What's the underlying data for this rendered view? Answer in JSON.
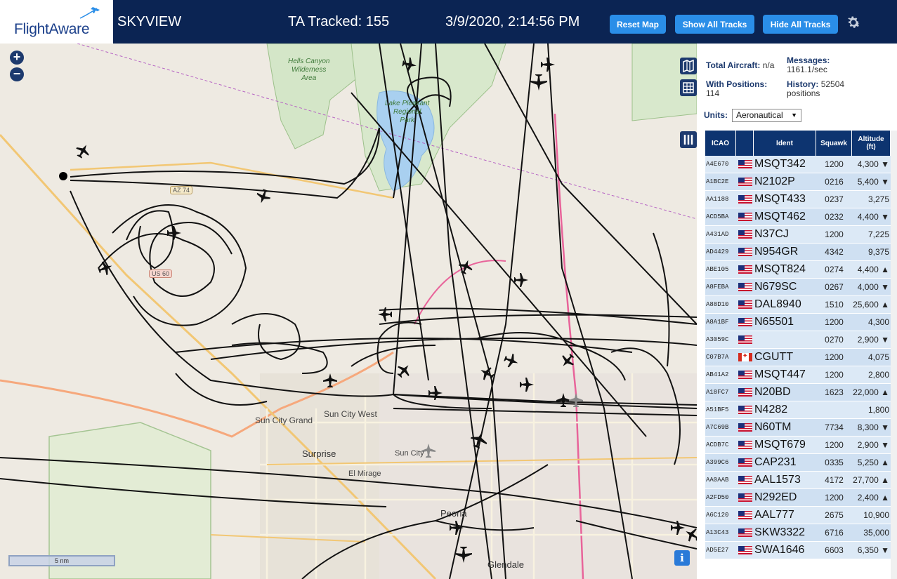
{
  "header": {
    "logo": "FlightAware",
    "title": "SKYVIEW",
    "tracked": "TA Tracked: 155",
    "datetime": "3/9/2020, 2:14:56 PM",
    "buttons": {
      "reset": "Reset Map",
      "show": "Show All Tracks",
      "hide": "Hide All Tracks"
    },
    "settings_icon": "gear-icon"
  },
  "map": {
    "zoom_in": "+",
    "zoom_out": "−",
    "scale": "5 nm",
    "info": "i",
    "labels": {
      "hells_canyon": "Hells Canyon\nWilderness\nArea",
      "lake_pleasant": "Lake Pleasant\nRegional\nPark",
      "sun_city_grand": "Sun City Grand",
      "sun_city_west": "Sun City West",
      "surprise": "Surprise",
      "sun_city": "Sun City",
      "el_mirage": "El Mirage",
      "peoria": "Peoria",
      "glendale": "Glendale"
    },
    "shields": {
      "az74": "AZ 74",
      "us60": "US 60"
    }
  },
  "sidebar": {
    "total_aircraft_label": "Total Aircraft:",
    "total_aircraft_value": "n/a",
    "messages_label": "Messages:",
    "messages_value": "1161.1/sec",
    "with_positions_label": "With Positions:",
    "with_positions_value": "114",
    "history_label": "History:",
    "history_value": "52504",
    "history_unit": "positions",
    "units_label": "Units:",
    "units_value": "Aeronautical",
    "columns": [
      "ICAO",
      "",
      "Ident",
      "Squawk",
      "Altitude (ft)"
    ],
    "rows": [
      {
        "icao": "A4E670",
        "flag": "us",
        "ident": "MSQT342",
        "squawk": "1200",
        "alt": "4,300 ▼"
      },
      {
        "icao": "A1BC2E",
        "flag": "us",
        "ident": "N2102P",
        "squawk": "0216",
        "alt": "5,400 ▼"
      },
      {
        "icao": "AA1188",
        "flag": "us",
        "ident": "MSQT433",
        "squawk": "0237",
        "alt": "3,275"
      },
      {
        "icao": "ACD5BA",
        "flag": "us",
        "ident": "MSQT462",
        "squawk": "0232",
        "alt": "4,400 ▼"
      },
      {
        "icao": "A431AD",
        "flag": "us",
        "ident": "N37CJ",
        "squawk": "1200",
        "alt": "7,225"
      },
      {
        "icao": "AD4429",
        "flag": "us",
        "ident": "N954GR",
        "squawk": "4342",
        "alt": "9,375"
      },
      {
        "icao": "ABE105",
        "flag": "us",
        "ident": "MSQT824",
        "squawk": "0274",
        "alt": "4,400 ▲"
      },
      {
        "icao": "A8FEBA",
        "flag": "us",
        "ident": "N679SC",
        "squawk": "0267",
        "alt": "4,000 ▼"
      },
      {
        "icao": "A88D10",
        "flag": "us",
        "ident": "DAL8940",
        "squawk": "1510",
        "alt": "25,600 ▲"
      },
      {
        "icao": "A8A1BF",
        "flag": "us",
        "ident": "N65501",
        "squawk": "1200",
        "alt": "4,300"
      },
      {
        "icao": "A3059C",
        "flag": "us",
        "ident": "",
        "squawk": "0270",
        "alt": "2,900 ▼"
      },
      {
        "icao": "C07B7A",
        "flag": "ca",
        "ident": "CGUTT",
        "squawk": "1200",
        "alt": "4,075"
      },
      {
        "icao": "AB41A2",
        "flag": "us",
        "ident": "MSQT447",
        "squawk": "1200",
        "alt": "2,800"
      },
      {
        "icao": "A18FC7",
        "flag": "us",
        "ident": "N20BD",
        "squawk": "1623",
        "alt": "22,000 ▲"
      },
      {
        "icao": "A51BF5",
        "flag": "us",
        "ident": "N4282",
        "squawk": "",
        "alt": "1,800"
      },
      {
        "icao": "A7C69B",
        "flag": "us",
        "ident": "N60TM",
        "squawk": "7734",
        "alt": "8,300 ▼"
      },
      {
        "icao": "ACDB7C",
        "flag": "us",
        "ident": "MSQT679",
        "squawk": "1200",
        "alt": "2,900 ▼"
      },
      {
        "icao": "A399C6",
        "flag": "us",
        "ident": "CAP231",
        "squawk": "0335",
        "alt": "5,250 ▲"
      },
      {
        "icao": "AA0AAB",
        "flag": "us",
        "ident": "AAL1573",
        "squawk": "4172",
        "alt": "27,700 ▲"
      },
      {
        "icao": "A2FD50",
        "flag": "us",
        "ident": "N292ED",
        "squawk": "1200",
        "alt": "2,400 ▲"
      },
      {
        "icao": "A6C120",
        "flag": "us",
        "ident": "AAL777",
        "squawk": "2675",
        "alt": "10,900"
      },
      {
        "icao": "A13C43",
        "flag": "us",
        "ident": "SKW3322",
        "squawk": "6716",
        "alt": "35,000"
      },
      {
        "icao": "AD5E27",
        "flag": "us",
        "ident": "SWA1646",
        "squawk": "6603",
        "alt": "6,350 ▼"
      }
    ]
  },
  "colors": {
    "header_bg": "#0b2453",
    "button_bg": "#2a8ee8",
    "table_header_bg": "#0d3470",
    "row_bg": "#dce9f6"
  }
}
